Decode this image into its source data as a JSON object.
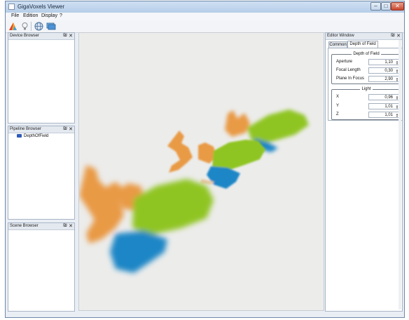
{
  "window": {
    "title": "GigaVoxels Viewer",
    "controls": {
      "minimize": "–",
      "maximize": "□",
      "close": "✕"
    }
  },
  "menu": [
    "File",
    "Edition",
    "Display",
    "?"
  ],
  "toolbar": {
    "icons": [
      "color-triangle-icon",
      "light-bulb-icon",
      "globe-icon",
      "stack-icon"
    ]
  },
  "panels": {
    "device_browser": {
      "title": "Device Browser",
      "float": "₪",
      "close": "✕"
    },
    "pipeline_browser": {
      "title": "Pipeline Browser",
      "float": "₪",
      "close": "✕",
      "items": [
        "DepthOfField"
      ]
    },
    "scene_browser": {
      "title": "Scene Browser",
      "float": "₪",
      "close": "✕"
    },
    "editor": {
      "title": "Editor Window",
      "float": "₪",
      "close": "✕",
      "tabs": [
        "Common",
        "Depth of Field"
      ],
      "active_tab": "Depth of Field",
      "dof_group": {
        "title": "Depth of Field",
        "rows": [
          {
            "label": "Aperture",
            "value": "1,10"
          },
          {
            "label": "Focal Length",
            "value": "0,30"
          },
          {
            "label": "Plane In Focus",
            "value": "2,90"
          }
        ]
      },
      "light_group": {
        "title": "Light",
        "rows": [
          {
            "label": "X",
            "value": "0,96"
          },
          {
            "label": "Y",
            "value": "1,01"
          },
          {
            "label": "Z",
            "value": "1,01"
          }
        ]
      }
    }
  },
  "viewport": {
    "scene": "three-dragon-models-depth-of-field",
    "colors": {
      "orange": "#e99a45",
      "green": "#8fc520",
      "blue": "#1f86c6",
      "background": "#ececeb"
    }
  }
}
